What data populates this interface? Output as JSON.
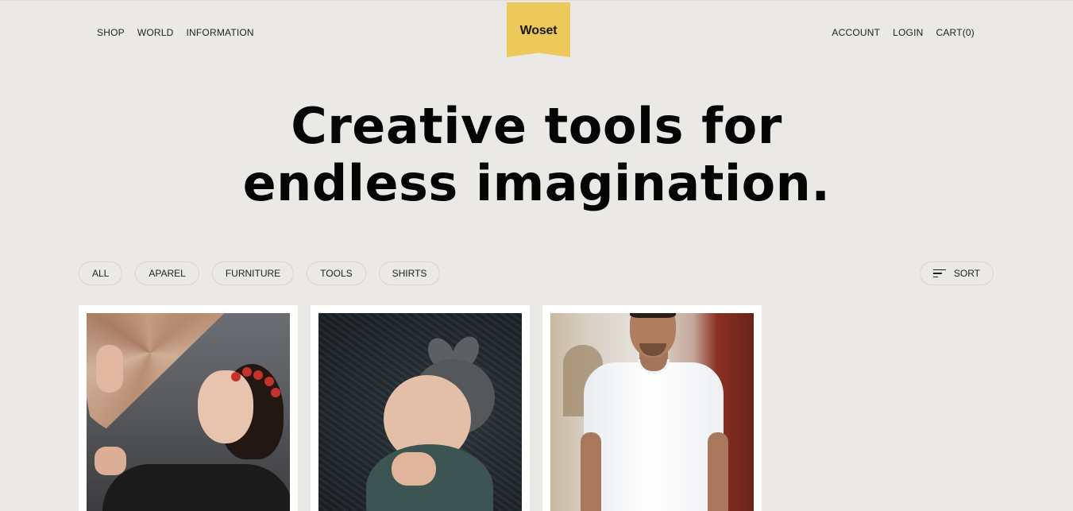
{
  "nav": {
    "left": [
      "SHOP",
      "WORLD",
      "INFORMATION"
    ],
    "right": [
      "ACCOUNT",
      "LOGIN",
      "CART(0)"
    ]
  },
  "logo": "Woset",
  "hero": {
    "line1": "Creative tools for",
    "line2": "endless imagination."
  },
  "filters": [
    "ALL",
    "APAREL",
    "FURNITURE",
    "TOOLS",
    "SHIRTS"
  ],
  "sort": {
    "label": "SORT",
    "icon": "sort-icon"
  },
  "colors": {
    "background": "#ebe9e6",
    "logo_badge": "#ecc95a",
    "card": "#ffffff"
  }
}
